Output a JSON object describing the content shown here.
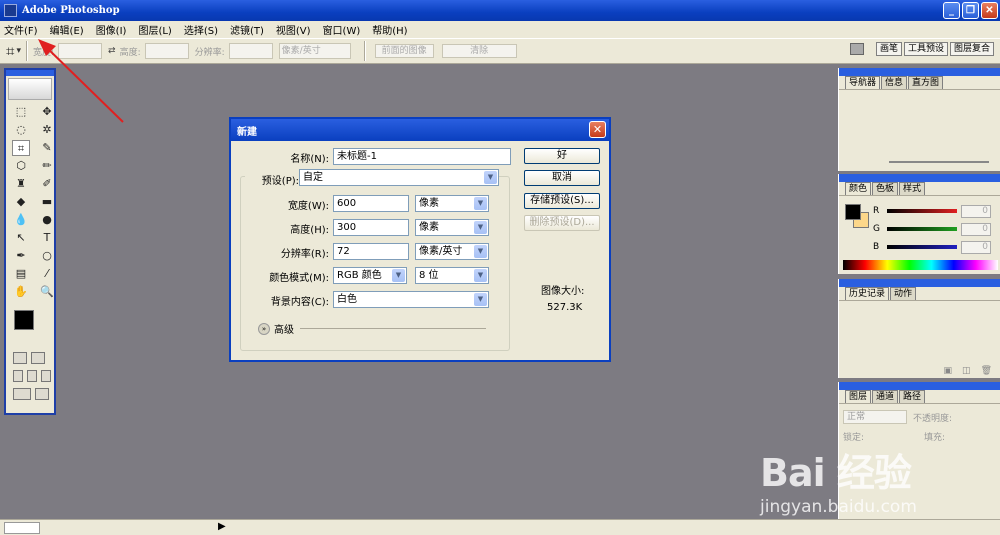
{
  "window": {
    "title": "Adobe Photoshop"
  },
  "menubar": [
    "文件(F)",
    "编辑(E)",
    "图像(I)",
    "图层(L)",
    "选择(S)",
    "滤镜(T)",
    "视图(V)",
    "窗口(W)",
    "帮助(H)"
  ],
  "options": {
    "width_label": "宽度:",
    "height_label": "高度:",
    "resolution_label": "分辨率:",
    "unit_select": "像素/英寸",
    "front_image": "前面的图像",
    "clear": "清除"
  },
  "well_tabs": [
    "画笔",
    "工具预设",
    "图层复合"
  ],
  "dialog": {
    "title": "新建",
    "name_label": "名称(N):",
    "name_value": "未标题-1",
    "preset_label": "预设(P):",
    "preset_value": "自定",
    "width_label": "宽度(W):",
    "width_value": "600",
    "width_unit": "像素",
    "height_label": "高度(H):",
    "height_value": "300",
    "height_unit": "像素",
    "resolution_label": "分辨率(R):",
    "resolution_value": "72",
    "resolution_unit": "像素/英寸",
    "colormode_label": "颜色模式(M):",
    "colormode_value": "RGB 颜色",
    "bitdepth_value": "8 位",
    "background_label": "背景内容(C):",
    "background_value": "白色",
    "advanced": "高级",
    "ok": "好",
    "cancel": "取消",
    "save_preset": "存储预设(S)...",
    "delete_preset": "删除预设(D)...",
    "image_size_label": "图像大小:",
    "image_size_value": "527.3K"
  },
  "panels": {
    "navigator_tabs": [
      "导航器",
      "信息",
      "直方图"
    ],
    "color_tabs": [
      "颜色",
      "色板",
      "样式"
    ],
    "color_channels": [
      {
        "label": "R",
        "value": "0",
        "color": "#e02020"
      },
      {
        "label": "G",
        "value": "0",
        "color": "#20a020"
      },
      {
        "label": "B",
        "value": "0",
        "color": "#2020c0"
      }
    ],
    "history_tabs": [
      "历史记录",
      "动作"
    ],
    "layers_tabs": [
      "图层",
      "通道",
      "路径"
    ],
    "blend_mode": "正常",
    "opacity_label": "不透明度:",
    "lock_label": "锁定:",
    "fill_label": "填充:"
  },
  "watermark": {
    "main": "Bai 经验",
    "sub": "jingyan.baidu.com"
  },
  "colors": {
    "titlebar": "#0a3fbf",
    "canvas": "#7d7b82",
    "fg": "#000000",
    "bg": "#fcd78a"
  }
}
